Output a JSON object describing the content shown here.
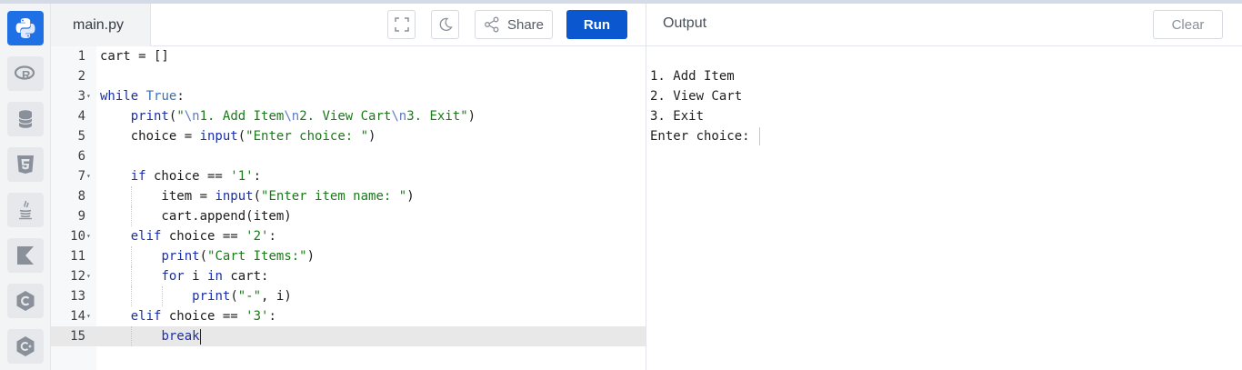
{
  "editor": {
    "file_name": "main.py",
    "share_label": "Share",
    "run_label": "Run",
    "lines": [
      {
        "n": "1",
        "fold": false
      },
      {
        "n": "2",
        "fold": false
      },
      {
        "n": "3",
        "fold": true
      },
      {
        "n": "4",
        "fold": false
      },
      {
        "n": "5",
        "fold": false
      },
      {
        "n": "6",
        "fold": false
      },
      {
        "n": "7",
        "fold": true
      },
      {
        "n": "8",
        "fold": false
      },
      {
        "n": "9",
        "fold": false
      },
      {
        "n": "10",
        "fold": true
      },
      {
        "n": "11",
        "fold": false
      },
      {
        "n": "12",
        "fold": true
      },
      {
        "n": "13",
        "fold": false
      },
      {
        "n": "14",
        "fold": true
      },
      {
        "n": "15",
        "fold": false
      }
    ],
    "code": [
      "cart = []",
      "",
      "while True:",
      "    print(\"\\n1. Add Item\\n2. View Cart\\n3. Exit\")",
      "    choice = input(\"Enter choice: \")",
      "",
      "    if choice == '1':",
      "        item = input(\"Enter item name: \")",
      "        cart.append(item)",
      "    elif choice == '2':",
      "        print(\"Cart Items:\")",
      "        for i in cart:",
      "            print(\"-\", i)",
      "    elif choice == '3':",
      "        break"
    ]
  },
  "sidebar": {
    "items": [
      {
        "name": "python",
        "active": true
      },
      {
        "name": "r"
      },
      {
        "name": "sql"
      },
      {
        "name": "html5"
      },
      {
        "name": "java"
      },
      {
        "name": "kotlin"
      },
      {
        "name": "c"
      },
      {
        "name": "cpp"
      }
    ]
  },
  "output": {
    "title": "Output",
    "clear_label": "Clear",
    "lines": [
      "1. Add Item",
      "2. View Cart",
      "3. Exit",
      "Enter choice: "
    ]
  },
  "colors": {
    "accent": "#0a57cf",
    "active_lang": "#1f6fe5"
  }
}
